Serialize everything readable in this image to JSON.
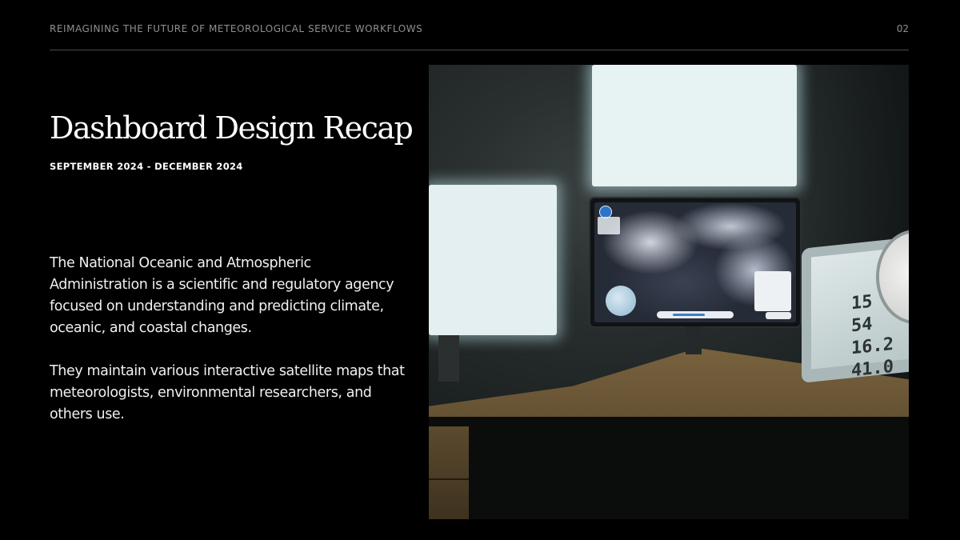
{
  "header": {
    "title": "REIMAGINING THE FUTURE OF METEOROLOGICAL SERVICE WORKFLOWS",
    "page_number": "02"
  },
  "slide": {
    "title": "Dashboard Design Recap",
    "subtitle": "SEPTEMBER 2024 - DECEMBER 2024",
    "paragraphs": [
      "The National Oceanic and Atmospheric Administration is a scientific and regulatory agency focused on understanding and predicting climate, oceanic, and coastal changes.",
      "They maintain various interactive satellite maps that meteorologists, environmental researchers, and others use."
    ]
  },
  "illustration": {
    "subject": "weather-station-desk-illustration",
    "station_readout": [
      "15",
      "54",
      "16.2",
      "41.0"
    ]
  },
  "colors": {
    "background": "#000000",
    "text_primary": "#ffffff",
    "text_muted": "#8f8f8f",
    "rule": "#4a4a4a",
    "screen_glow": "#e7f2f3",
    "desk": "#7b6540"
  }
}
